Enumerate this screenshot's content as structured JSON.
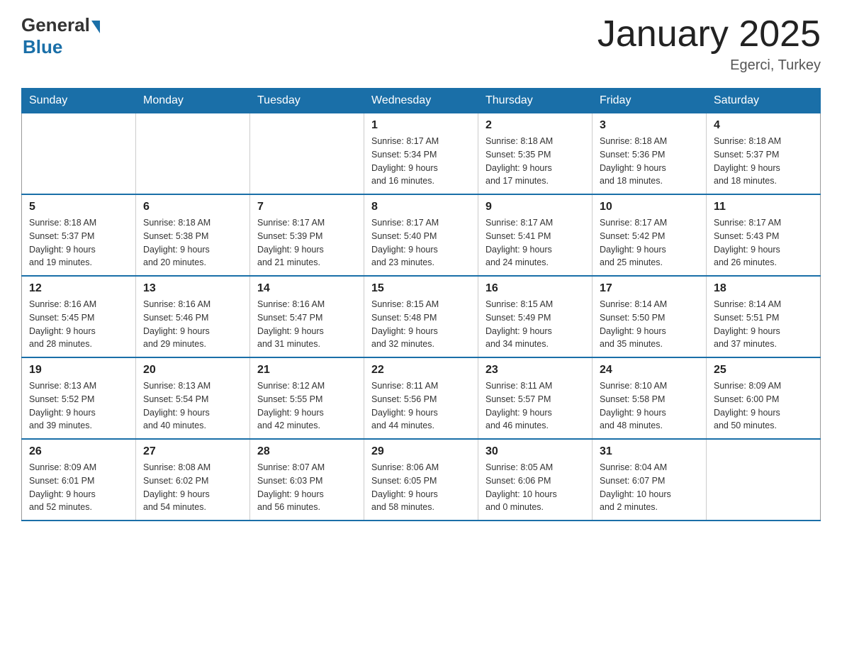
{
  "header": {
    "logo_general": "General",
    "logo_blue": "Blue",
    "title": "January 2025",
    "location": "Egerci, Turkey"
  },
  "days_of_week": [
    "Sunday",
    "Monday",
    "Tuesday",
    "Wednesday",
    "Thursday",
    "Friday",
    "Saturday"
  ],
  "weeks": [
    {
      "days": [
        {
          "number": "",
          "info": ""
        },
        {
          "number": "",
          "info": ""
        },
        {
          "number": "",
          "info": ""
        },
        {
          "number": "1",
          "info": "Sunrise: 8:17 AM\nSunset: 5:34 PM\nDaylight: 9 hours\nand 16 minutes."
        },
        {
          "number": "2",
          "info": "Sunrise: 8:18 AM\nSunset: 5:35 PM\nDaylight: 9 hours\nand 17 minutes."
        },
        {
          "number": "3",
          "info": "Sunrise: 8:18 AM\nSunset: 5:36 PM\nDaylight: 9 hours\nand 18 minutes."
        },
        {
          "number": "4",
          "info": "Sunrise: 8:18 AM\nSunset: 5:37 PM\nDaylight: 9 hours\nand 18 minutes."
        }
      ]
    },
    {
      "days": [
        {
          "number": "5",
          "info": "Sunrise: 8:18 AM\nSunset: 5:37 PM\nDaylight: 9 hours\nand 19 minutes."
        },
        {
          "number": "6",
          "info": "Sunrise: 8:18 AM\nSunset: 5:38 PM\nDaylight: 9 hours\nand 20 minutes."
        },
        {
          "number": "7",
          "info": "Sunrise: 8:17 AM\nSunset: 5:39 PM\nDaylight: 9 hours\nand 21 minutes."
        },
        {
          "number": "8",
          "info": "Sunrise: 8:17 AM\nSunset: 5:40 PM\nDaylight: 9 hours\nand 23 minutes."
        },
        {
          "number": "9",
          "info": "Sunrise: 8:17 AM\nSunset: 5:41 PM\nDaylight: 9 hours\nand 24 minutes."
        },
        {
          "number": "10",
          "info": "Sunrise: 8:17 AM\nSunset: 5:42 PM\nDaylight: 9 hours\nand 25 minutes."
        },
        {
          "number": "11",
          "info": "Sunrise: 8:17 AM\nSunset: 5:43 PM\nDaylight: 9 hours\nand 26 minutes."
        }
      ]
    },
    {
      "days": [
        {
          "number": "12",
          "info": "Sunrise: 8:16 AM\nSunset: 5:45 PM\nDaylight: 9 hours\nand 28 minutes."
        },
        {
          "number": "13",
          "info": "Sunrise: 8:16 AM\nSunset: 5:46 PM\nDaylight: 9 hours\nand 29 minutes."
        },
        {
          "number": "14",
          "info": "Sunrise: 8:16 AM\nSunset: 5:47 PM\nDaylight: 9 hours\nand 31 minutes."
        },
        {
          "number": "15",
          "info": "Sunrise: 8:15 AM\nSunset: 5:48 PM\nDaylight: 9 hours\nand 32 minutes."
        },
        {
          "number": "16",
          "info": "Sunrise: 8:15 AM\nSunset: 5:49 PM\nDaylight: 9 hours\nand 34 minutes."
        },
        {
          "number": "17",
          "info": "Sunrise: 8:14 AM\nSunset: 5:50 PM\nDaylight: 9 hours\nand 35 minutes."
        },
        {
          "number": "18",
          "info": "Sunrise: 8:14 AM\nSunset: 5:51 PM\nDaylight: 9 hours\nand 37 minutes."
        }
      ]
    },
    {
      "days": [
        {
          "number": "19",
          "info": "Sunrise: 8:13 AM\nSunset: 5:52 PM\nDaylight: 9 hours\nand 39 minutes."
        },
        {
          "number": "20",
          "info": "Sunrise: 8:13 AM\nSunset: 5:54 PM\nDaylight: 9 hours\nand 40 minutes."
        },
        {
          "number": "21",
          "info": "Sunrise: 8:12 AM\nSunset: 5:55 PM\nDaylight: 9 hours\nand 42 minutes."
        },
        {
          "number": "22",
          "info": "Sunrise: 8:11 AM\nSunset: 5:56 PM\nDaylight: 9 hours\nand 44 minutes."
        },
        {
          "number": "23",
          "info": "Sunrise: 8:11 AM\nSunset: 5:57 PM\nDaylight: 9 hours\nand 46 minutes."
        },
        {
          "number": "24",
          "info": "Sunrise: 8:10 AM\nSunset: 5:58 PM\nDaylight: 9 hours\nand 48 minutes."
        },
        {
          "number": "25",
          "info": "Sunrise: 8:09 AM\nSunset: 6:00 PM\nDaylight: 9 hours\nand 50 minutes."
        }
      ]
    },
    {
      "days": [
        {
          "number": "26",
          "info": "Sunrise: 8:09 AM\nSunset: 6:01 PM\nDaylight: 9 hours\nand 52 minutes."
        },
        {
          "number": "27",
          "info": "Sunrise: 8:08 AM\nSunset: 6:02 PM\nDaylight: 9 hours\nand 54 minutes."
        },
        {
          "number": "28",
          "info": "Sunrise: 8:07 AM\nSunset: 6:03 PM\nDaylight: 9 hours\nand 56 minutes."
        },
        {
          "number": "29",
          "info": "Sunrise: 8:06 AM\nSunset: 6:05 PM\nDaylight: 9 hours\nand 58 minutes."
        },
        {
          "number": "30",
          "info": "Sunrise: 8:05 AM\nSunset: 6:06 PM\nDaylight: 10 hours\nand 0 minutes."
        },
        {
          "number": "31",
          "info": "Sunrise: 8:04 AM\nSunset: 6:07 PM\nDaylight: 10 hours\nand 2 minutes."
        },
        {
          "number": "",
          "info": ""
        }
      ]
    }
  ]
}
